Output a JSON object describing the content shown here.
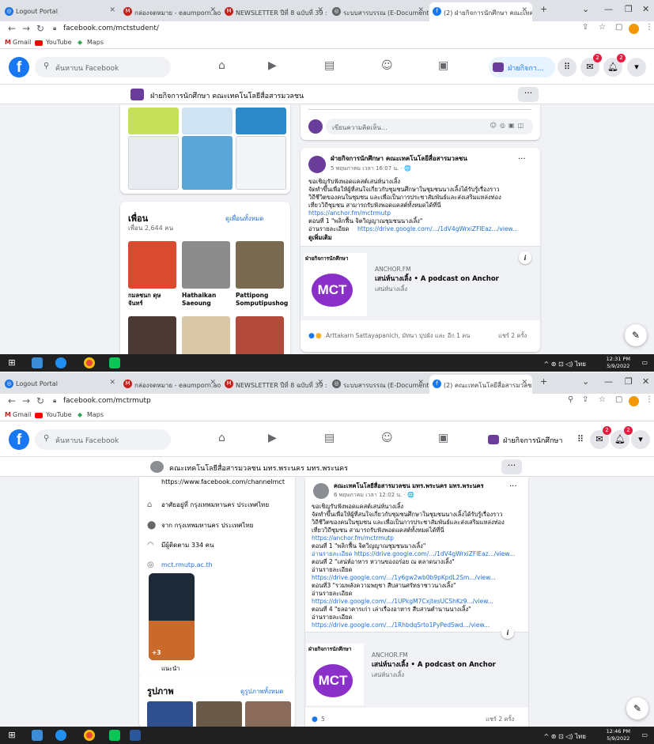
{
  "screens": [
    {
      "tabs": [
        {
          "label": "Logout Portal"
        },
        {
          "label": "กล่องจดหมาย - eaumporn.aor@"
        },
        {
          "label": "NEWSLETTER ปีที่ 8 ฉบับที่ 39 :"
        },
        {
          "label": "ระบบสารบรรณ (E-Document S"
        },
        {
          "label": "(2) ฝ่ายกิจการนักศึกษา คณะเทคโ"
        }
      ],
      "url": "facebook.com/mctstudent/",
      "bookmarks": [
        "Gmail",
        "YouTube",
        "Maps"
      ],
      "search_placeholder": "ค้นหาบน Facebook",
      "nav_page_label": "ฝ่ายกิจกา...",
      "messenger_badge": "2",
      "notif_badge": "2",
      "page_title": "ฝ่ายกิจการนักศึกษา คณะเทคโนโลยีสื่อสารมวลชน",
      "friends": {
        "heading": "เพื่อน",
        "see_all": "ดูเพื่อนทั้งหมด",
        "count": "เพื่อน 2,644 คน",
        "people": [
          {
            "name_line1": "กมลชนก ดุษ",
            "name_line2": "จันทร์",
            "color": "#d94a2f"
          },
          {
            "name_line1": "Hathaikan",
            "name_line2": "Saeoung",
            "color": "#8c8c8c"
          },
          {
            "name_line1": "Pattipong",
            "name_line2": "Somputipushog",
            "color": "#7a6a4f"
          }
        ]
      },
      "comment_placeholder": "เขียนความคิดเห็น...",
      "post": {
        "author": "ฝ่ายกิจการนักศึกษา คณะเทคโนโลยีสื่อสารมวลชน",
        "time": "5 พฤษภาคม เวลา 16:07 น. · 🌐",
        "lines": [
          "ขอเชิญรับฟังพอดแคสต์เสน่ห์นางเลิ้ง",
          "จัดทำขึ้นเพื่อให้ผู้ที่สนใจเกี่ยวกับชุมชนศึกษาในชุมชนนางเลิ้งได้รับรู้เรื่องราว",
          "วิถีชีวิตของคนในชุมชน และเพื่อเป็นการประชาสัมพันธ์และส่งเสริมแหล่งท่อง",
          "เที่ยววิถีชุมชน สามารถรับฟังพอดแคสต์ทั้งหมดได้ที่นี่"
        ],
        "link1": "https://anchor.fm/mctrmutp",
        "episode": "ตอนที่ 1 \"พลิกฟื้น จิตวิญญาณชุมชนนางเลิ้ง\"",
        "detail_label": "อ่านรายละเอียด",
        "detail_link": "https://drive.google.com/.../1dV4gWrxiZFlEaz.../view...",
        "see_more": "ดูเพิ่มเติม",
        "podcast_source": "ANCHOR.FM",
        "podcast_title": "เสน่ห์นางเลิ้ง • A podcast on Anchor",
        "podcast_sub": "เสน่ห์นางเลิ้ง",
        "logo_caption": "ฝ่ายกิจการนักศึกษา",
        "logo_text": "MCT",
        "reactions": "Arttakarn Sattayapanich, มัทนา ปุปผัง และ อีก 1 คน",
        "shares": "แชร์ 2 ครั้ง"
      },
      "clock_time": "12:31 PM",
      "clock_date": "5/9/2022"
    },
    {
      "tabs": [
        {
          "label": "Logout Portal"
        },
        {
          "label": "กล่องจดหมาย - eaumporn.aor@"
        },
        {
          "label": "NEWSLETTER ปีที่ 8 ฉบับที่ 39 :"
        },
        {
          "label": "ระบบสารบรรณ (E-Document S"
        },
        {
          "label": "(2) คณะเทคโนโลยีสื่อสารมวลช"
        }
      ],
      "url": "facebook.com/mctrmutp",
      "bookmarks": [
        "Gmail",
        "YouTube",
        "Maps"
      ],
      "search_placeholder": "ค้นหาบน Facebook",
      "nav_page_label": "ฝ่ายกิจการนักศึกษา",
      "messenger_badge": "2",
      "notif_badge": "2",
      "page_title": "คณะเทคโนโลยีสื่อสารมวลชน มทร.พระนคร มทร.พระนคร",
      "intro": {
        "website_top": "https://www.facebook.com/channelmct",
        "lives_in": "อาศัยอยู่ที่ กรุงเทพมหานคร ประเทศไทย",
        "from": "จาก กรุงเทพมหานคร ประเทศไทย",
        "followers": "มีผู้ติดตาม 334 คน",
        "website": "mct.rmutp.ac.th",
        "featured_count": "+3",
        "featured_label": "แนะนำ"
      },
      "photos": {
        "heading": "รูปภาพ",
        "see_all": "ดูรูปภาพทั้งหมด"
      },
      "post": {
        "author": "คณะเทคโนโลยีสื่อสารมวลชน มทร.พระนคร มทร.พระนคร",
        "time": "6 พฤษภาคม เวลา 12:02 น. · 🌐",
        "lines": [
          "ขอเชิญรับฟังพอดแคสต์เสน่ห์นางเลิ้ง",
          "จัดทำขึ้นเพื่อให้ผู้ที่สนใจเกี่ยวกับชุมชนศึกษาในชุมชนนางเลิ้งได้รับรู้เรื่องราว",
          "วิถีชีวิตของคนในชุมชน และเพื่อเป็นการประชาสัมพันธ์และส่งเสริมแหล่งท่อง",
          "เที่ยววิถีชุมชน สามารถรับฟังพอดแคสต์ทั้งหมดได้ที่นี่"
        ],
        "link1": "https://anchor.fm/mctrmutp",
        "ep1": "ตอนที่ 1 \"พลิกฟื้น จิตวิญญาณชุมชนนางเลิ้ง\"",
        "ep1_link": "อ่านรายละเอียด https://drive.google.com/.../1dV4gWrxiZFlEaz.../view...",
        "ep2": "ตอนที่ 2 \"เสน่ห์อาหาร หวานของอร่อย ณ ตลาดนางเลิ้ง\"",
        "ep2_label": "อ่านรายละเอียด",
        "ep2_link": "https://drive.google.com/.../1y6gw2wb0b9pKpdL2Sm.../view...",
        "ep3": "ตอนที่3 \"รวมพลังความพยุชา สืบสานศรัทธาชาวนางเลิ้ง\"",
        "ep3_label": "อ่านรายละเอียด",
        "ep3_link": "https://drive.google.com/.../1UPkgM7CxjtesUCShKz9.../view...",
        "ep4": "ตอนที่ 4 \"ยลอาคารเก่า เล่าเรื่องอาหาร สืบสานตำนานนางเลิ้ง\"",
        "ep4_label": "อ่านรายละเอียด",
        "ep4_link": "https://drive.google.com/.../1RhbdqSrto1PyPedSwd.../view...",
        "podcast_source": "ANCHOR.FM",
        "podcast_title": "เสน่ห์นางเลิ้ง • A podcast on Anchor",
        "podcast_sub": "เสน่ห์นางเลิ้ง",
        "logo_caption": "ฝ่ายกิจการนักศึกษา",
        "logo_text": "MCT",
        "reaction_count": "5",
        "shares": "แชร์ 2 ครั้ง"
      },
      "clock_time": "12:46 PM",
      "clock_date": "5/9/2022"
    }
  ],
  "colors": {
    "facebook_blue": "#1877f2",
    "mct_purple": "#8b2fc9",
    "link": "#216fdb"
  }
}
